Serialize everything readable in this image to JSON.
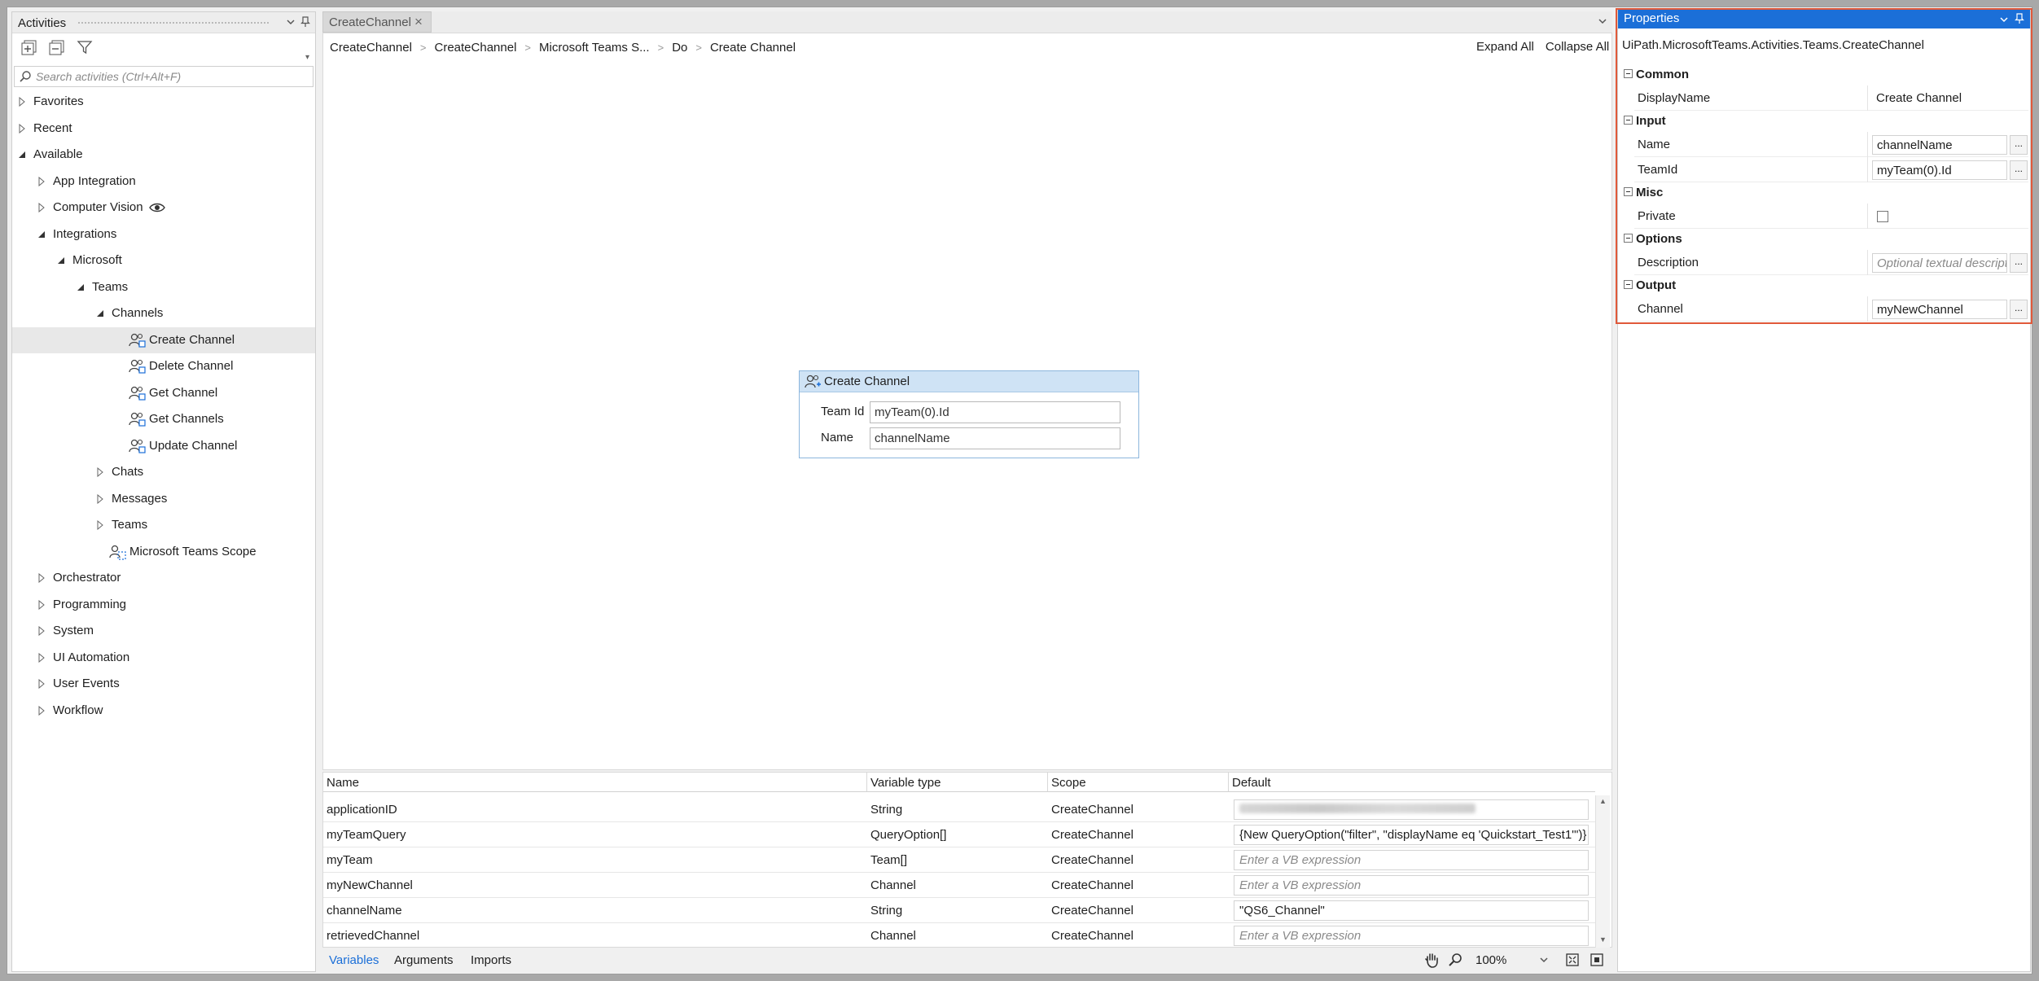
{
  "activities_panel": {
    "title": "Activities",
    "search_placeholder": "Search activities (Ctrl+Alt+F)",
    "tree": [
      {
        "label": "Favorites",
        "level": 0,
        "state": "collapsed"
      },
      {
        "label": "Recent",
        "level": 0,
        "state": "collapsed"
      },
      {
        "label": "Available",
        "level": 0,
        "state": "expanded"
      },
      {
        "label": "App Integration",
        "level": 1,
        "state": "collapsed"
      },
      {
        "label": "Computer Vision",
        "level": 1,
        "state": "collapsed",
        "icon": "eye-icon"
      },
      {
        "label": "Integrations",
        "level": 1,
        "state": "expanded"
      },
      {
        "label": "Microsoft",
        "level": 2,
        "state": "expanded"
      },
      {
        "label": "Teams",
        "level": 3,
        "state": "expanded"
      },
      {
        "label": "Channels",
        "level": 4,
        "state": "expanded"
      },
      {
        "label": "Create Channel",
        "level": 5,
        "state": "leaf",
        "icon": "create-channel-icon",
        "selected": true
      },
      {
        "label": "Delete Channel",
        "level": 5,
        "state": "leaf",
        "icon": "delete-channel-icon"
      },
      {
        "label": "Get Channel",
        "level": 5,
        "state": "leaf",
        "icon": "get-channel-icon"
      },
      {
        "label": "Get Channels",
        "level": 5,
        "state": "leaf",
        "icon": "get-channels-icon"
      },
      {
        "label": "Update Channel",
        "level": 5,
        "state": "leaf",
        "icon": "update-channel-icon"
      },
      {
        "label": "Chats",
        "level": 4,
        "state": "collapsed"
      },
      {
        "label": "Messages",
        "level": 4,
        "state": "collapsed"
      },
      {
        "label": "Teams",
        "level": 4,
        "state": "collapsed"
      },
      {
        "label": "Microsoft Teams Scope",
        "level": 4,
        "state": "leaf",
        "icon": "teams-scope-icon"
      },
      {
        "label": "Orchestrator",
        "level": 1,
        "state": "collapsed"
      },
      {
        "label": "Programming",
        "level": 1,
        "state": "collapsed"
      },
      {
        "label": "System",
        "level": 1,
        "state": "collapsed"
      },
      {
        "label": "UI Automation",
        "level": 1,
        "state": "collapsed"
      },
      {
        "label": "User Events",
        "level": 1,
        "state": "collapsed"
      },
      {
        "label": "Workflow",
        "level": 1,
        "state": "collapsed"
      }
    ]
  },
  "designer": {
    "tab_label": "CreateChannel",
    "breadcrumb": [
      "CreateChannel",
      "CreateChannel",
      "Microsoft Teams S...",
      "Do",
      "Create Channel"
    ],
    "expand_all": "Expand All",
    "collapse_all": "Collapse All",
    "activity": {
      "title": "Create Channel",
      "team_id_label": "Team Id",
      "team_id_value": "myTeam(0).Id",
      "name_label": "Name",
      "name_value": "channelName"
    }
  },
  "variables": {
    "columns": [
      "Name",
      "Variable type",
      "Scope",
      "Default"
    ],
    "rows": [
      {
        "name": "applicationID",
        "type": "String",
        "scope": "CreateChannel",
        "default": "",
        "blurred": true
      },
      {
        "name": "myTeamQuery",
        "type": "QueryOption[]",
        "scope": "CreateChannel",
        "default": "{New QueryOption(\"filter\", \"displayName eq 'Quickstart_Test1'\")}"
      },
      {
        "name": "myTeam",
        "type": "Team[]",
        "scope": "CreateChannel",
        "default": "Enter a VB expression",
        "placeholder": true
      },
      {
        "name": "myNewChannel",
        "type": "Channel",
        "scope": "CreateChannel",
        "default": "Enter a VB expression",
        "placeholder": true
      },
      {
        "name": "channelName",
        "type": "String",
        "scope": "CreateChannel",
        "default": "\"QS6_Channel\""
      },
      {
        "name": "retrievedChannel",
        "type": "Channel",
        "scope": "CreateChannel",
        "default": "Enter a VB expression",
        "placeholder": true
      }
    ],
    "bottom_tabs": [
      "Variables",
      "Arguments",
      "Imports"
    ],
    "zoom": "100%"
  },
  "properties": {
    "title": "Properties",
    "type_name": "UiPath.MicrosoftTeams.Activities.Teams.CreateChannel",
    "categories": [
      {
        "name": "Common",
        "props": [
          {
            "name": "DisplayName",
            "value": "Create Channel",
            "kind": "plain"
          }
        ]
      },
      {
        "name": "Input",
        "props": [
          {
            "name": "Name",
            "value": "channelName",
            "kind": "expr"
          },
          {
            "name": "TeamId",
            "value": "myTeam(0).Id",
            "kind": "expr"
          }
        ]
      },
      {
        "name": "Misc",
        "props": [
          {
            "name": "Private",
            "value": "",
            "kind": "checkbox"
          }
        ]
      },
      {
        "name": "Options",
        "props": [
          {
            "name": "Description",
            "value": "Optional textual description",
            "kind": "placeholder"
          }
        ]
      },
      {
        "name": "Output",
        "props": [
          {
            "name": "Channel",
            "value": "myNewChannel",
            "kind": "expr"
          }
        ]
      }
    ]
  },
  "colors": {
    "properties_header": "#1b6fd8",
    "highlight_border": "#e0593a",
    "activity_header": "#cfe3f5",
    "link_blue": "#1b6fd8"
  }
}
